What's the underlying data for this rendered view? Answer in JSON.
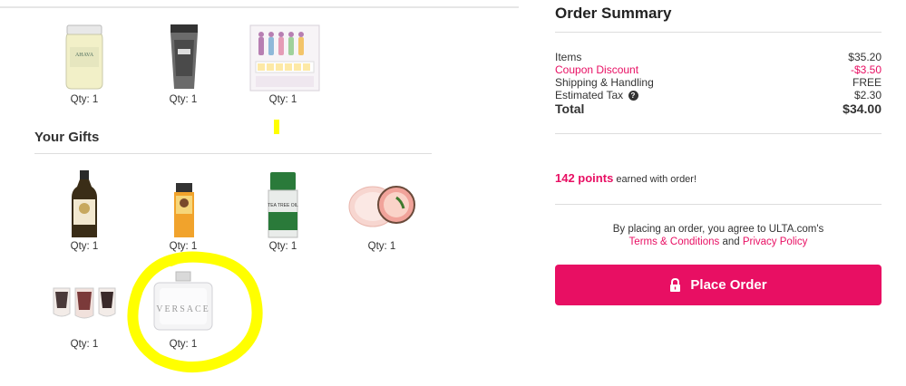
{
  "products": [
    {
      "name": "ahava-jar",
      "qty": "Qty: 1"
    },
    {
      "name": "charcoal-tube",
      "qty": "Qty: 1"
    },
    {
      "name": "mini-palette-set",
      "qty": "Qty: 1"
    }
  ],
  "gifts": {
    "title": "Your Gifts",
    "items": [
      {
        "name": "shampoo-bottle",
        "qty": "Qty: 1"
      },
      {
        "name": "hand-cream",
        "qty": "Qty: 1"
      },
      {
        "name": "tea-tree-oil",
        "qty": "Qty: 1"
      },
      {
        "name": "body-butter",
        "qty": "Qty: 1"
      },
      {
        "name": "mini-polish-trio",
        "qty": "Qty: 1"
      },
      {
        "name": "versace-perfume",
        "qty": "Qty: 1",
        "brand_text": "VERSACE"
      }
    ]
  },
  "summary": {
    "title": "Order Summary",
    "items_label": "Items",
    "items_value": "$35.20",
    "coupon_label": "Coupon Discount",
    "coupon_value": "-$3.50",
    "shipping_label": "Shipping & Handling",
    "shipping_value": "FREE",
    "tax_label": "Estimated Tax",
    "tax_value": "$2.30",
    "total_label": "Total",
    "total_value": "$34.00",
    "points_value": "142 points",
    "points_text": "earned with order!",
    "agree_text": "By placing an order, you agree to ULTA.com's",
    "terms_link": "Terms & Conditions",
    "and_text": "and",
    "privacy_link": "Privacy Policy",
    "place_order_label": "Place Order"
  },
  "colors": {
    "accent": "#e80f63",
    "highlight": "#ffff00"
  },
  "icons": {
    "lock": "lock-icon",
    "help": "help-icon"
  }
}
